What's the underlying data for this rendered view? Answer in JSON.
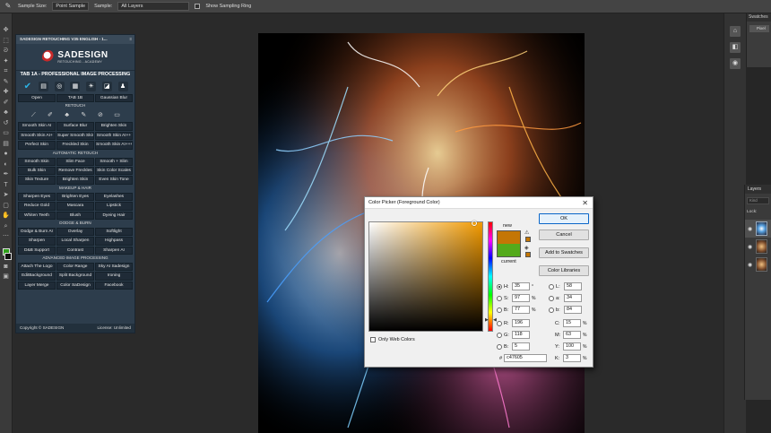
{
  "options_bar": {
    "sample_size_label": "Sample Size:",
    "sample_size_value": "Point Sample",
    "sample_label": "Sample:",
    "sample_value": "All Layers",
    "show_ring_label": "Show Sampling Ring"
  },
  "sadesign": {
    "panel_title": "SADESIGN RETOUCHING V35 ENGLISH - 1...",
    "logo_name": "SADESIGN",
    "logo_sub": "RETOUCHING - ACADEMY",
    "tab_title": "TAB 1A - PROFESSIONAL IMAGE PROCESSING",
    "top_buttons": [
      "Open",
      "TAB 1B",
      "Gaussian Blur"
    ],
    "retouch_label": "RETOUCH",
    "retouch_rows": [
      [
        "Smooth Skin AI",
        "Surface Blur",
        "Brighten Skin"
      ],
      [
        "Smooth Skin AI+",
        "Super Smooth Skin",
        "Smooth Skin AI++"
      ],
      [
        "Perfect Skin",
        "Freckled Skin",
        "Smooth Skin AI+++"
      ]
    ],
    "auto_retouch_label": "AUTOMATIC RETOUCH",
    "auto_rows": [
      [
        "Smooth Skin",
        "Slim Face",
        "Smooth + Slim"
      ],
      [
        "Bulk Skin",
        "Remove Freckles",
        "Skin Color Scales"
      ],
      [
        "Skin Texture",
        "Brighten Skin",
        "Even Skin Tone"
      ]
    ],
    "makeup_label": "MAKEUP & HAIR",
    "makeup_rows": [
      [
        "Sharpen Eyes",
        "Brighten Eyes",
        "Eyelashes"
      ],
      [
        "Reduce Gold",
        "Mascara",
        "Lipstick"
      ],
      [
        "Whiten Teeth",
        "Blush",
        "Dyeing Hair"
      ]
    ],
    "dodge_label": "DODGE & BURN",
    "dodge_rows": [
      [
        "Dodge & Burn AI",
        "Overlay",
        "Softlight"
      ],
      [
        "Sharpen",
        "Local Sharpen",
        "Highpass"
      ],
      [
        "D&B Support",
        "Contrast",
        "Sharpen AI"
      ]
    ],
    "advanced_label": "ADVANCED IMAGE PROCESSING",
    "advanced_rows": [
      [
        "Attach The Logo",
        "Color Range",
        "Sky AI Sadesign"
      ],
      [
        "EditBackground",
        "Split Background",
        "Ironing"
      ],
      [
        "Layer Merge",
        "Color SaDesign",
        "Facebook"
      ]
    ],
    "footer_left": "Copyright © SADESIGN",
    "footer_right": "License: Unlimited"
  },
  "right_panels": {
    "swatches_title": "Swatches",
    "swatches_item": "Pixel",
    "layers_title": "Layers",
    "layers_kind": "Kind",
    "layers_lock": "Lock:"
  },
  "color_picker": {
    "title": "Color Picker (Foreground Color)",
    "close": "✕",
    "new_label": "new",
    "current_label": "current",
    "new_color": "#c47605",
    "current_color": "#54aa1b",
    "ok": "OK",
    "cancel": "Cancel",
    "add_to_swatches": "Add to Swatches",
    "color_libraries": "Color Libraries",
    "web_only": "Only Web Colors",
    "hsb": {
      "H": "35",
      "S": "97",
      "B": "77"
    },
    "hsb_units": {
      "H": "°",
      "S": "%",
      "B": "%"
    },
    "rgb": {
      "R": "196",
      "G": "118",
      "B": "5"
    },
    "lab": {
      "L": "58",
      "a": "34",
      "b": "84"
    },
    "cmyk": {
      "C": "15",
      "M": "63",
      "Y": "100",
      "K": "3"
    },
    "hex_label": "#",
    "hex": "c47605"
  }
}
